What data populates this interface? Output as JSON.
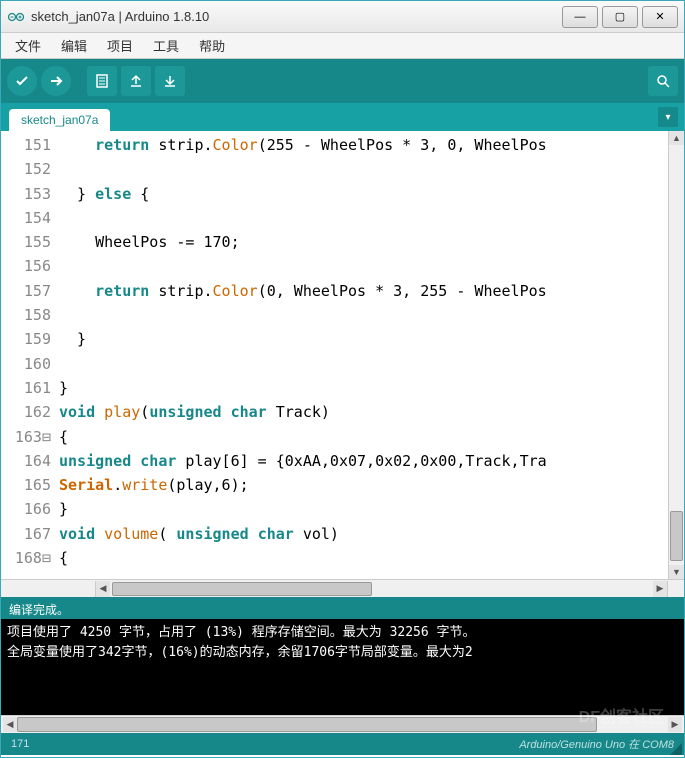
{
  "window": {
    "title": "sketch_jan07a | Arduino 1.8.10"
  },
  "menu": {
    "file": "文件",
    "edit": "编辑",
    "sketch": "项目",
    "tools": "工具",
    "help": "帮助"
  },
  "tab": {
    "label": "sketch_jan07a"
  },
  "code": {
    "lines": [
      {
        "n": "151",
        "html": "    <span class='kw'>return</span> strip.<span class='fn'>Color</span>(255 - WheelPos * 3, 0, WheelPos"
      },
      {
        "n": "152",
        "html": " "
      },
      {
        "n": "153",
        "html": "  } <span class='kw'>else</span> {"
      },
      {
        "n": "154",
        "html": " "
      },
      {
        "n": "155",
        "html": "    WheelPos -= 170;"
      },
      {
        "n": "156",
        "html": " "
      },
      {
        "n": "157",
        "html": "    <span class='kw'>return</span> strip.<span class='fn'>Color</span>(0, WheelPos * 3, 255 - WheelPos"
      },
      {
        "n": "158",
        "html": " "
      },
      {
        "n": "159",
        "html": "  }"
      },
      {
        "n": "160",
        "html": " "
      },
      {
        "n": "161",
        "html": "}"
      },
      {
        "n": "162",
        "html": "<span class='kw'>void</span> <span class='fn'>play</span>(<span class='kw'>unsigned</span> <span class='kw'>char</span> Track)"
      },
      {
        "n": "163",
        "html": "{",
        "fold": true
      },
      {
        "n": "164",
        "html": "<span class='kw'>unsigned</span> <span class='kw'>char</span> play[6] = {0xAA,0x07,0x02,0x00,Track,Tra"
      },
      {
        "n": "165",
        "html": "<span class='orange'>Serial</span>.<span class='fn'>write</span>(play,6);"
      },
      {
        "n": "166",
        "html": "}"
      },
      {
        "n": "167",
        "html": "<span class='kw'>void</span> <span class='fn'>volume</span>( <span class='kw'>unsigned</span> <span class='kw'>char</span> vol)"
      },
      {
        "n": "168",
        "html": "{",
        "fold": true
      }
    ]
  },
  "status": {
    "compile": "编译完成。"
  },
  "console": {
    "line1": "项目使用了 4250 字节，占用了 (13%) 程序存储空间。最大为 32256 字节。",
    "line2": "全局变量使用了342字节，(16%)的动态内存，余留1706字节局部变量。最大为2"
  },
  "bottom": {
    "line": "171",
    "board": "Arduino/Genuino Uno 在 COM8"
  },
  "watermark": "DF创客社区"
}
